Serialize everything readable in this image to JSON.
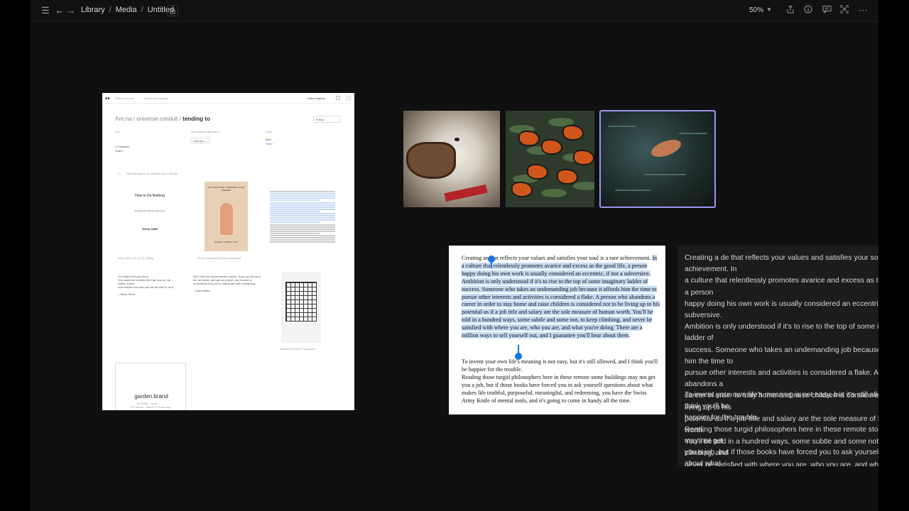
{
  "topbar": {
    "breadcrumb": [
      "Library",
      "Media",
      "Untitled"
    ],
    "zoom": "50%",
    "icons": [
      "menu-icon",
      "back-arrow-icon",
      "forward-arrow-icon",
      "lock-icon",
      "share-icon",
      "info-icon",
      "comment-icon",
      "fullscreen-icon",
      "more-icon"
    ]
  },
  "arena": {
    "search_left": "Seek in Are.na",
    "search_right": "Search this channel",
    "new_channel": "+ New channel",
    "title_user": "Are.na / universe conduit / ",
    "title_channel": "tending to",
    "follow": "Follow",
    "info_label": "Info",
    "followers": "1 Followers",
    "connect_label": "This channel appears in",
    "connect": "Connect →",
    "view_label": "View",
    "view_grid": "Grid",
    "view_table": "Table ↑",
    "filter": "Filter tending to (1 channel and 4 blocks)",
    "book1": {
      "title": "How to Do Nothing",
      "subtitle": "Resisting the Attention Economy",
      "author": "Jenny Odell"
    },
    "book1_caption": "jenny_odell_how_to_do_nothing...",
    "book2": {
      "title": "LET YOUR BODY INTERPRET YOUR DREAMS",
      "author": "EUGENE T. GENDLIN, PH.D."
    },
    "book2_caption": "let-your-body-interpret-your-dreams.pdf",
    "quote1": "You listen and you know\nYou could live a better life than you do, be\nSofter, kinder.\nAnd maybe this year you will be able to do it.\n\n—Mary Oliver",
    "quote2": "But I'll tell you what hermits realize. If you go off into a far, far forest, and get very quiet, you'll come to understand that you're connected with everything.\n\n—Alan Watts",
    "crossword_caption": "Finished my first NYT crossword",
    "garden": "garden.brand",
    "garden_meta": "by Potter · sean",
    "garden_meta2": "472 blocks · about 17 hours ago"
  },
  "document": {
    "p1_before": "Creating a",
    "p1_mid": "e that reflects your values and satisfies your soul is a rare achievement. ",
    "p1_selected": "In a culture that relentlessly promotes avarice and excess as the good life, a person happy doing his own work is usually considered an eccentric, if not a subversive. Ambition is only understood if it's to rise to the top of some imaginary ladder of success. Someone who takes an undemanding job because it affords him the time to pursue other interests and activities is considered a flake. A person who abandons a career in order to stay home and raise children is considered not to be living up to his potential-as if a job title and salary are the sole measure of human worth. You'll be told in a hundred ways, some subtle and some not, to keep climbing, and never be satisfied with where you are, who you are, and what you're doing. There are a million ways to sell yourself out, and I guarantee you'll hear about them",
    "p2": "To invent your own life's meaning is not easy, but it's still allowed, and I think you'll be happier for the trouble.\nReading those turgid philosophers here in these remote stone buildings may not get you a job, but if those books have forced you to ask yourself questions about what makes life truthful, purposeful, meaningful, and redeeming, you have the Swiss Army Knife of mental tools, and it's going to come in handy all the time."
  },
  "dark_panel": {
    "p1": "Creating a de that reflects your values and satisfies your soul is a rare achievement. In\na culture that relentlessly promotes avarice and excess as the good life, a person\nhappy doing his own work is usually considered an eccentric, if not a subversive.\nAmbition is only understood if it's to rise to the top of some imaginary ladder of\nsuccess. Someone who takes an undemanding job because it affords him the time to\npursue other interests and activities is considered a flake. A person who abandons a\ncareer in order to stay home and raise children is considered not to be living up to his\npotential-as if a job title and salary are the sole measure of human worth.\nYou'll be told in a hundred ways, some subtle and some not, to keep climbing, and\nnever be satisfied with where you are, who you are, and what you're doing. There are\na million ways to sell yourself out, and I guarantee you'll hear about them.",
    "p2": "To invent your own life's meaning is not easy, but it's still allowed, and I think you'll be\nhappier for the trouble.\nReading those turgid philosophers here in these remote stone buildings may not get\nyou a job, but if those books have forced you to ask yourself questions about what\nmakes life truthful, purposeful, meaningful, and redeeming, you have the Swiss Army\nKnife of mental tools, and it's going to come in handy all the time."
  }
}
